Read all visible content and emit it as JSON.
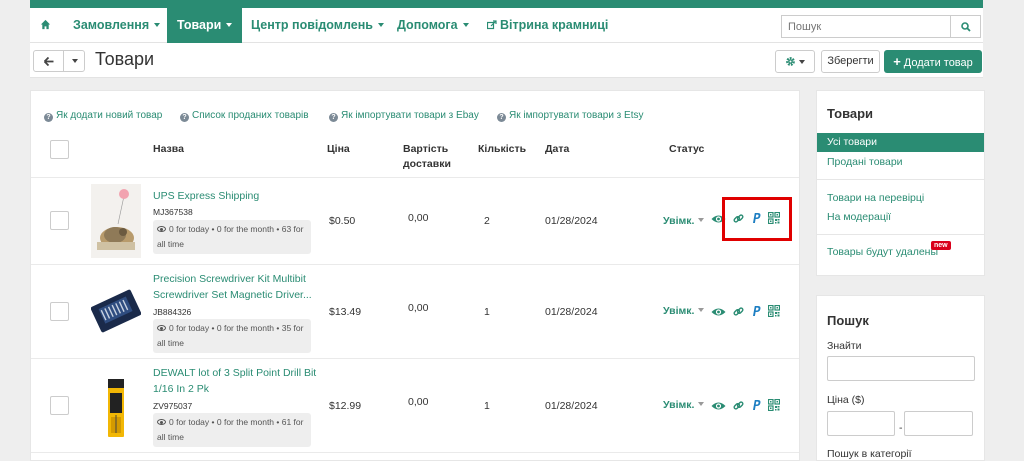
{
  "nav": {
    "home_icon": "home-icon",
    "items": [
      {
        "label": "Замовлення"
      },
      {
        "label": "Товари"
      },
      {
        "label": "Центр повідомлень"
      },
      {
        "label": "Допомога"
      },
      {
        "label": "Вітрина крамниці"
      }
    ],
    "search_placeholder": "Пошук"
  },
  "toolbar": {
    "title": "Товари",
    "save_label": "Зберегти",
    "add_label": "Додати товар"
  },
  "help_links": [
    "Як додати новий товар",
    "Список проданих товарів",
    "Як імпортувати товари з Ebay",
    "Як імпортувати товари з Etsy"
  ],
  "table": {
    "headers": {
      "name": "Назва",
      "price": "Ціна",
      "shipping": "Вартість доставки",
      "qty": "Кількість",
      "date": "Дата",
      "status": "Статус"
    },
    "rows": [
      {
        "name": "UPS Express Shipping",
        "sku": "MJ367538",
        "stats": "0 for today • 0 for the month • 63 for all time",
        "price": "$0.50",
        "shipping": "0,00",
        "qty": "2",
        "date": "01/28/2024",
        "status": "Увімк."
      },
      {
        "name": "Precision Screwdriver Kit Multibit Screwdriver Set Magnetic Driver...",
        "sku": "JB884326",
        "stats": "0 for today • 0 for the month • 35 for all time",
        "price": "$13.49",
        "shipping": "0,00",
        "qty": "1",
        "date": "01/28/2024",
        "status": "Увімк."
      },
      {
        "name": "DEWALT lot of 3 Split Point Drill Bit 1/16 In 2 Pk",
        "sku": "ZV975037",
        "stats": "0 for today • 0 for the month • 61 for all time",
        "price": "$12.99",
        "shipping": "0,00",
        "qty": "1",
        "date": "01/28/2024",
        "status": "Увімк."
      }
    ]
  },
  "sidebar": {
    "title": "Товари",
    "items": [
      "Усі товари",
      "Продані товари",
      "Товари на перевірці",
      "На модерації",
      "Товары будут удалены"
    ],
    "new_badge": "new",
    "search_title": "Пошук",
    "find_label": "Знайти",
    "price_label": "Ціна ($)",
    "range_sep": "-",
    "category_label": "Пошук в категорії"
  },
  "colors": {
    "accent": "#2a8c73",
    "highlight": "#e00000",
    "badge": "#d9001b"
  }
}
